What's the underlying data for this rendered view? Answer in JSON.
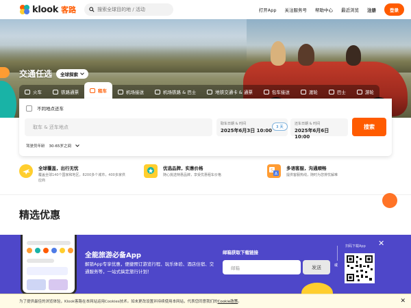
{
  "brand": {
    "name": "klook",
    "name_cn": "客路",
    "accent": "#ff5b00"
  },
  "header": {
    "search_placeholder": "搜索全球目的地 / 活动",
    "nav": [
      "打开App",
      "关注服务号",
      "帮助中心",
      "最近浏览",
      "注册"
    ],
    "signup": "登录"
  },
  "hero": {
    "title": "交通任选",
    "region_pill": "全球探索",
    "tabs": [
      "火车",
      "铁路通票",
      "租车",
      "机场接送",
      "机场铁路 & 巴士",
      "地铁交通卡 & 通票",
      "包车接送",
      "渡轮",
      "巴士",
      "游轮"
    ],
    "active_tab": "租车"
  },
  "booking": {
    "different_location": "不同地点还车",
    "location_placeholder": "取车 & 还车地点",
    "pickup_label": "取车日期 & 时间",
    "pickup_value": "2025年6月3日 10:00",
    "days_badge": "3 天",
    "return_label": "还车日期 & 时间",
    "return_value": "2025年6月6日 10:00",
    "search": "搜索",
    "driver_age_label": "驾驶员年龄",
    "driver_age_value": "30-65岁之间"
  },
  "features": [
    {
      "title": "全球覆盖，出行无忧",
      "desc": "覆盖全球140个国家和地区，8200多个城市，400多家供应商",
      "color": "#ffce2e",
      "icon": "globe-plane-icon"
    },
    {
      "title": "优选品牌，实惠价格",
      "desc": "随心挑选特惠品牌，享受优惠租车价格",
      "color": "#ffce2e",
      "icon": "award-badge-icon"
    },
    {
      "title": "多语客服，沟通顺畅",
      "desc": "提供客服热线，随时为您排忧解难",
      "color": "#ff9c33",
      "icon": "translate-icon"
    }
  ],
  "deals_title": "精选优惠",
  "promo": {
    "title": "全能旅游必备App",
    "desc": "解锁App专享优惠，便捷预订游览行程、玩乐体验、酒店住宿、交通服务等，一站式搞定旅行计划！",
    "email_label": "邮箱获取下载链接",
    "email_placeholder": "邮箱",
    "send": "发送",
    "or": "或",
    "qr_label": "扫码下载App"
  },
  "cookie": {
    "text": "为了提供最佳的浏览体验，Klook客路在本网站运用Cookies技术。如未更改设置并持续使用本网站，代表您同意我们的",
    "link": "Cookie政策",
    "end": "。"
  }
}
